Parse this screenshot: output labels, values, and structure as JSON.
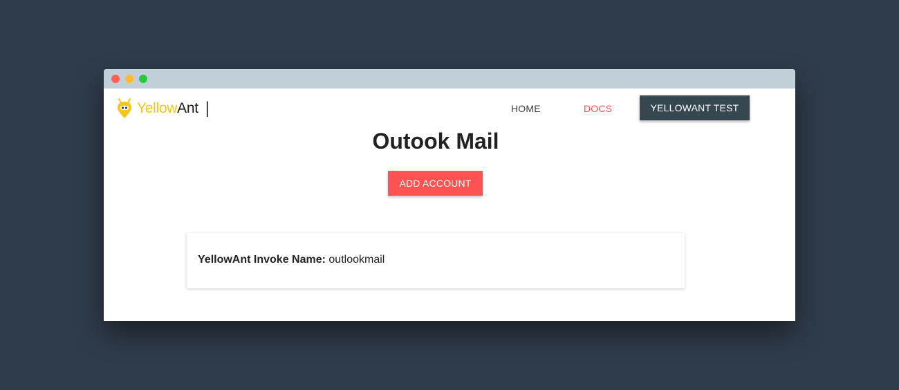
{
  "window": {
    "controls": [
      "close",
      "minimize",
      "maximize"
    ]
  },
  "logo": {
    "name_part1": "Yellow",
    "name_part2": "Ant",
    "separator": "|",
    "icon": "ant-mascot-icon",
    "brand_color": "#f5c518"
  },
  "nav": {
    "home_label": "HOME",
    "docs_label": "DOCS",
    "test_label": "YELLOWANT TEST"
  },
  "main": {
    "title": "Outook Mail",
    "add_button_label": "ADD ACCOUNT",
    "invoke_label": "YellowAnt Invoke Name:",
    "invoke_value": "outlookmail"
  },
  "colors": {
    "accent": "#ff5252",
    "nav_button": "#37474f",
    "background": "#2f3c4a",
    "titlebar": "#c1cfd9"
  }
}
